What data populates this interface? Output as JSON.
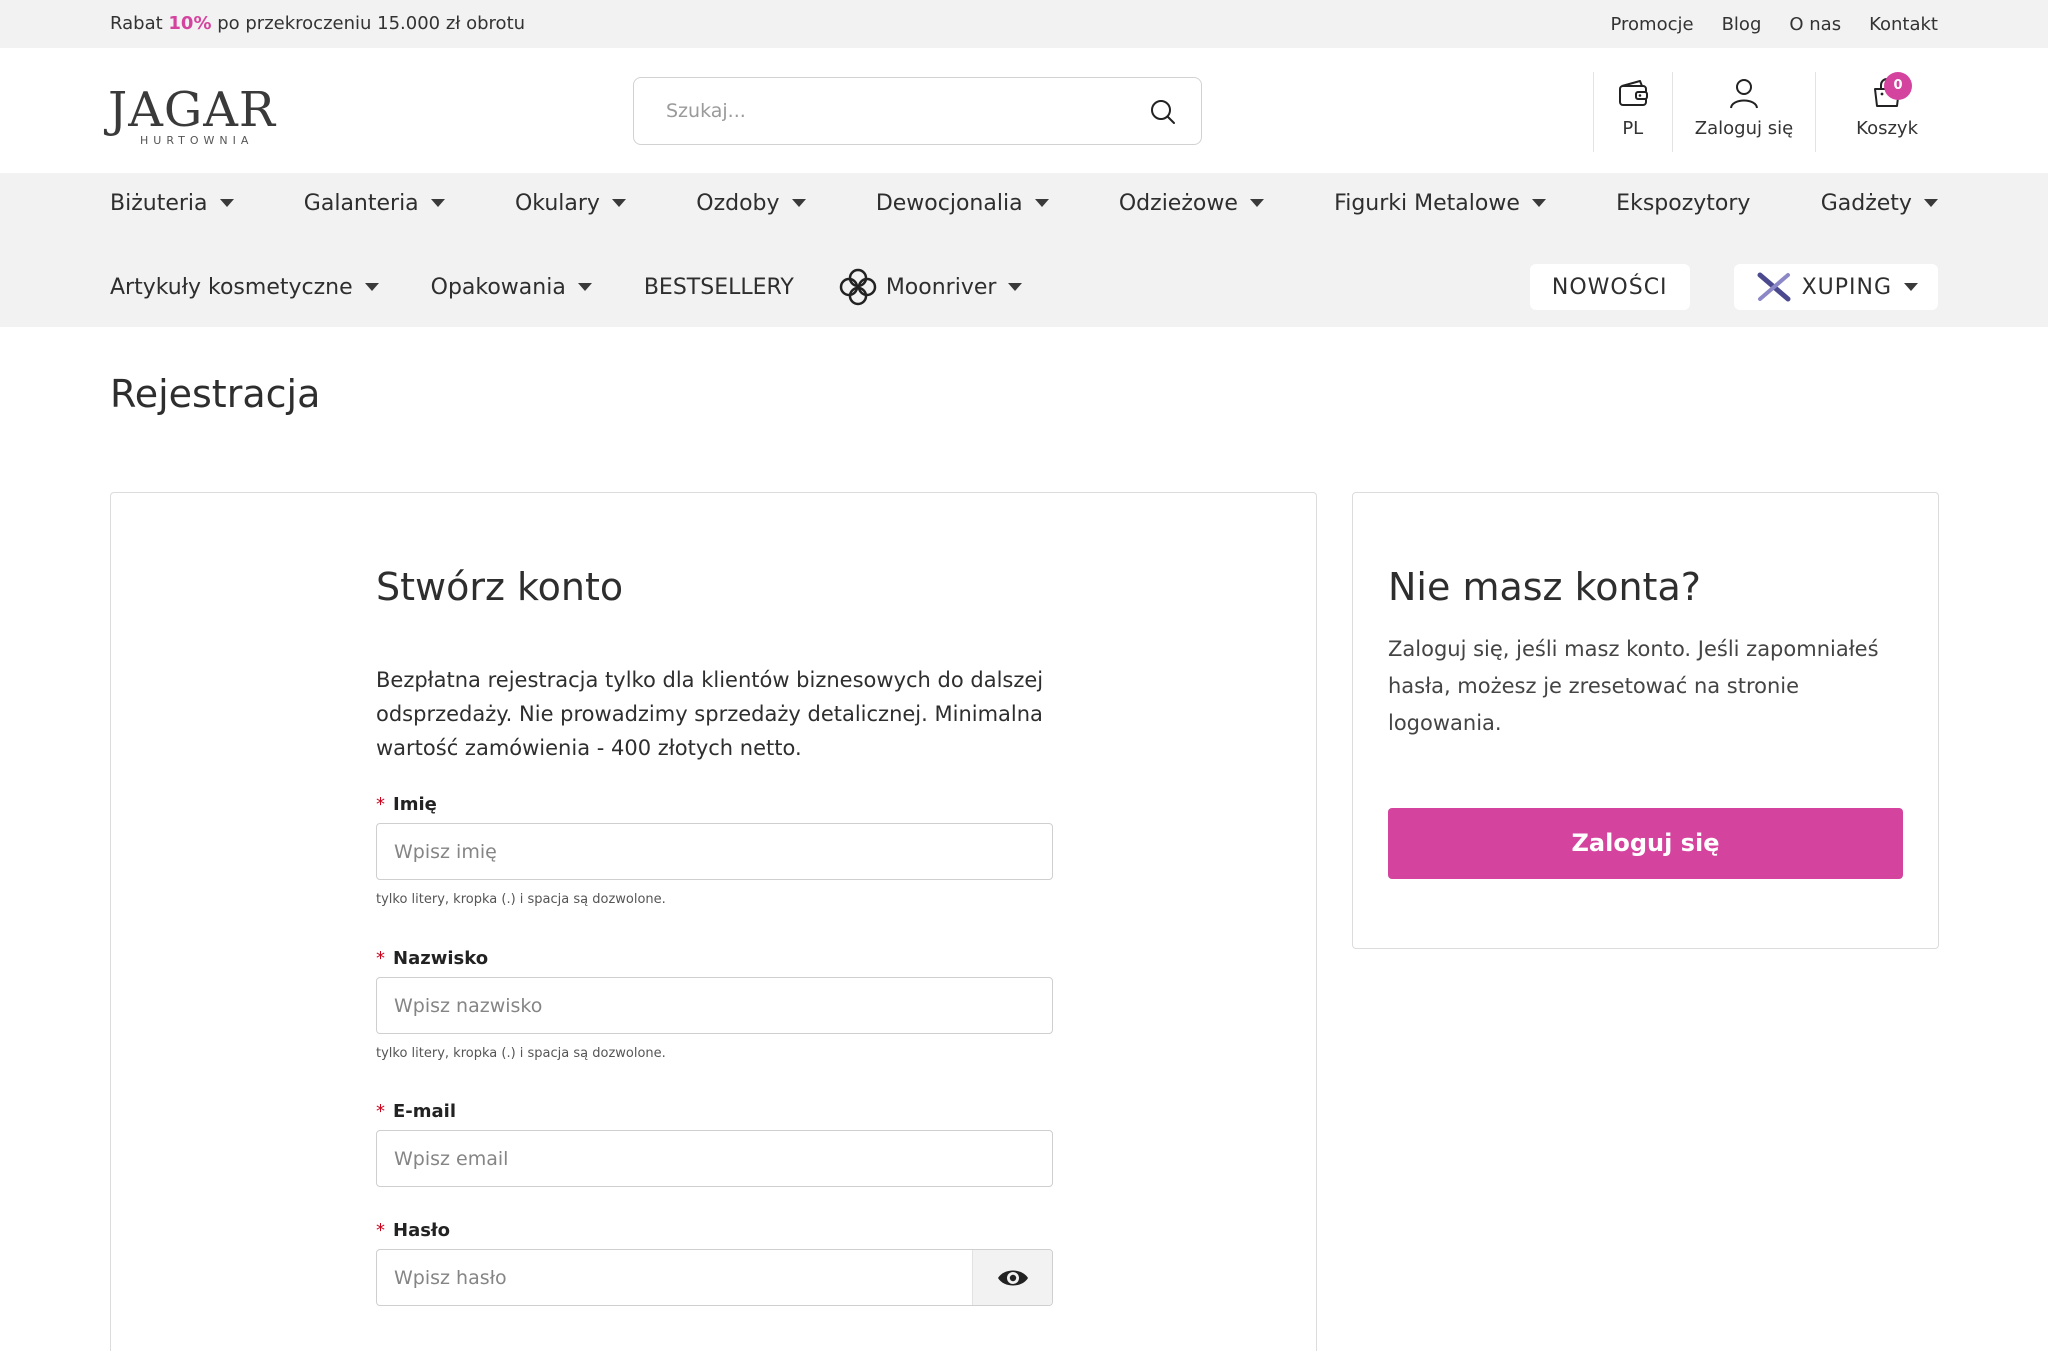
{
  "topbar": {
    "promo_prefix": "Rabat",
    "promo_percent": "10%",
    "promo_suffix": "po przekroczeniu 15.000 zł obrotu",
    "links": [
      "Promocje",
      "Blog",
      "O nas",
      "Kontakt"
    ]
  },
  "header": {
    "logo_main": "JAGAR",
    "logo_sub": "HURTOWNIA",
    "search_placeholder": "Szukaj...",
    "lang_label": "PL",
    "login_label": "Zaloguj się",
    "cart_label": "Koszyk",
    "cart_count": "0"
  },
  "nav": {
    "row1": [
      "Biżuteria",
      "Galanteria",
      "Okulary",
      "Ozdoby",
      "Dewocjonalia",
      "Odzieżowe",
      "Figurki Metalowe",
      "Ekspozytory",
      "Gadżety"
    ],
    "row2": [
      "Artykuły kosmetyczne",
      "Opakowania",
      "BESTSELLERY",
      "Moonriver"
    ],
    "new_label": "NOWOŚCI",
    "xuping_label": "XUPING"
  },
  "page": {
    "title": "Rejestracja"
  },
  "form": {
    "title": "Stwórz konto",
    "intro": "Bezpłatna rejestracja tylko dla klientów biznesowych do dalszej odsprzedaży. Nie prowadzimy sprzedaży detalicznej. Minimalna wartość zamówienia - 400 złotych netto.",
    "required_mark": "*",
    "first_name_label": "Imię",
    "first_name_placeholder": "Wpisz imię",
    "first_name_hint": "tylko litery, kropka (.) i spacja są dozwolone.",
    "last_name_label": "Nazwisko",
    "last_name_placeholder": "Wpisz nazwisko",
    "last_name_hint": "tylko litery, kropka (.) i spacja są dozwolone.",
    "email_label": "E-mail",
    "email_placeholder": "Wpisz email",
    "password_label": "Hasło",
    "password_placeholder": "Wpisz hasło"
  },
  "side": {
    "title": "Nie masz konta?",
    "text": "Zaloguj się, jeśli masz konto. Jeśli zapomniałeś hasła, możesz je zresetować na stronie logowania.",
    "button_label": "Zaloguj się"
  },
  "colors": {
    "accent": "#d4449f",
    "nav_bg": "#f2f2f2",
    "required": "#d0021b"
  }
}
